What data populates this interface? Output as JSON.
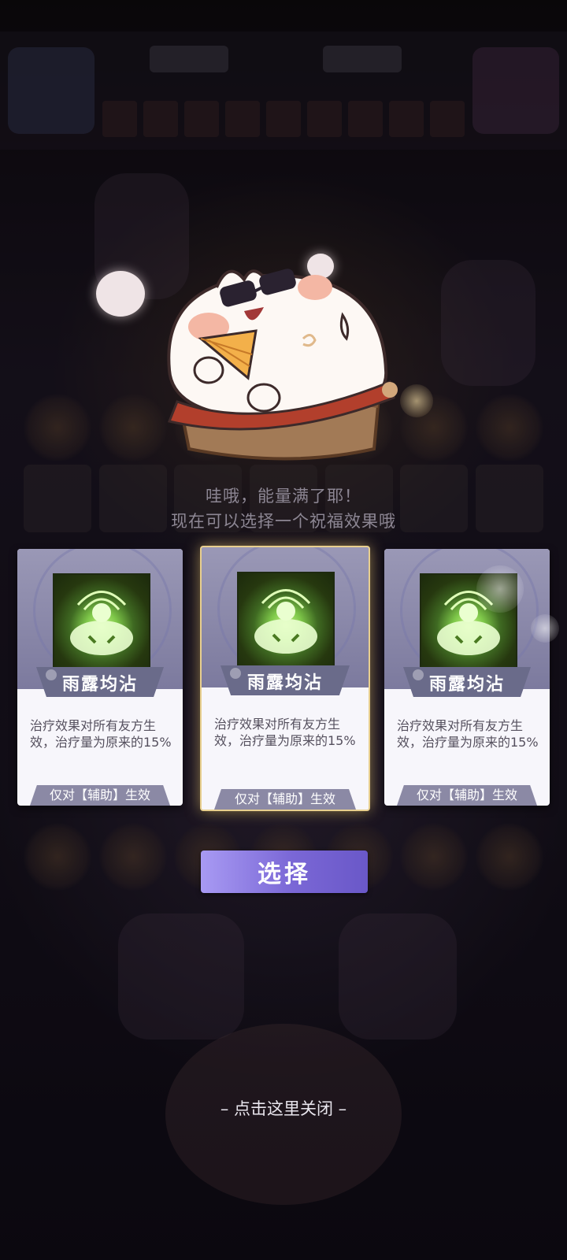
{
  "dialog": {
    "line1": "哇哦，能量满了耶！",
    "line2": "现在可以选择一个祝福效果哦"
  },
  "cards": [
    {
      "title": "雨露均沾",
      "description": "治疗效果对所有友方生效，治疗量为原来的15%",
      "restriction": "仅对【辅助】生效",
      "icon": "glowing-figure-icon",
      "selected": false
    },
    {
      "title": "雨露均沾",
      "description": "治疗效果对所有友方生效，治疗量为原来的15%",
      "restriction": "仅对【辅助】生效",
      "icon": "glowing-figure-icon",
      "selected": true
    },
    {
      "title": "雨露均沾",
      "description": "治疗效果对所有友方生效，治疗量为原来的15%",
      "restriction": "仅对【辅助】生效",
      "icon": "glowing-figure-icon",
      "selected": false
    }
  ],
  "select_button": {
    "label": "选择"
  },
  "close_hint": "– 点击这里关闭 –",
  "colors": {
    "card_header": "#8b89a5",
    "selected_border": "#e8cf8e",
    "button_gradient_start": "#a89af3",
    "button_gradient_end": "#6a58c8",
    "icon_glow": "#c9f58a"
  }
}
